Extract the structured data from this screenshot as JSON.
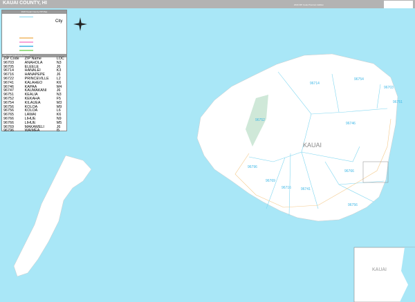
{
  "header": {
    "title": "KAUAI COUNTY, HI",
    "edition": "2020 ZIP Code Premium Edition",
    "logo": "MAPS"
  },
  "legend": {
    "title": "2020 Kauai County ZIP Map",
    "index_title": "ZIP Code Index/Grid Locator",
    "city_label": "City"
  },
  "table": {
    "headers": [
      "ZIP Code",
      "ZIP Name",
      "LOC"
    ],
    "rows": [
      [
        "96703",
        "ANAHOLA",
        "N3"
      ],
      [
        "96705",
        "ELEELE",
        "J6"
      ],
      [
        "96714",
        "HANALEI",
        "K3"
      ],
      [
        "96716",
        "HANAPEPE",
        "J6"
      ],
      [
        "96722",
        "PRINCEVILLE",
        "L2"
      ],
      [
        "96741",
        "KALAHEO",
        "K6"
      ],
      [
        "96746",
        "KAPAA",
        "M4"
      ],
      [
        "96747",
        "KAUMAKANI",
        "J6"
      ],
      [
        "96751",
        "KEALIA",
        "N3"
      ],
      [
        "96752",
        "KEKAHA",
        "F5"
      ],
      [
        "96754",
        "KILAUEA",
        "M3"
      ],
      [
        "96756",
        "KOLOA",
        "M9"
      ],
      [
        "96756",
        "KOLOA",
        "L6"
      ],
      [
        "96765",
        "LAWAI",
        "K6"
      ],
      [
        "96766",
        "LIHUE",
        "N9"
      ],
      [
        "96766",
        "LIHUE",
        "M5"
      ],
      [
        "96769",
        "MAKAWELI",
        "J6"
      ],
      [
        "96796",
        "WAIMEA",
        "I5"
      ]
    ]
  },
  "map": {
    "island_label": "KAUAI",
    "inset_label": "KAUAI",
    "zip_labels": [
      "96714",
      "96754",
      "96703",
      "96751",
      "96752",
      "96746",
      "96796",
      "96769",
      "96716",
      "96741",
      "96766",
      "96756"
    ],
    "colors": {
      "water": "#a9e7f7",
      "land": "#ffffff",
      "boundary": "#7fd6f0",
      "zip_label": "#3ab6e6",
      "park": "#cfe8d8",
      "road": "#f4c98a"
    }
  }
}
